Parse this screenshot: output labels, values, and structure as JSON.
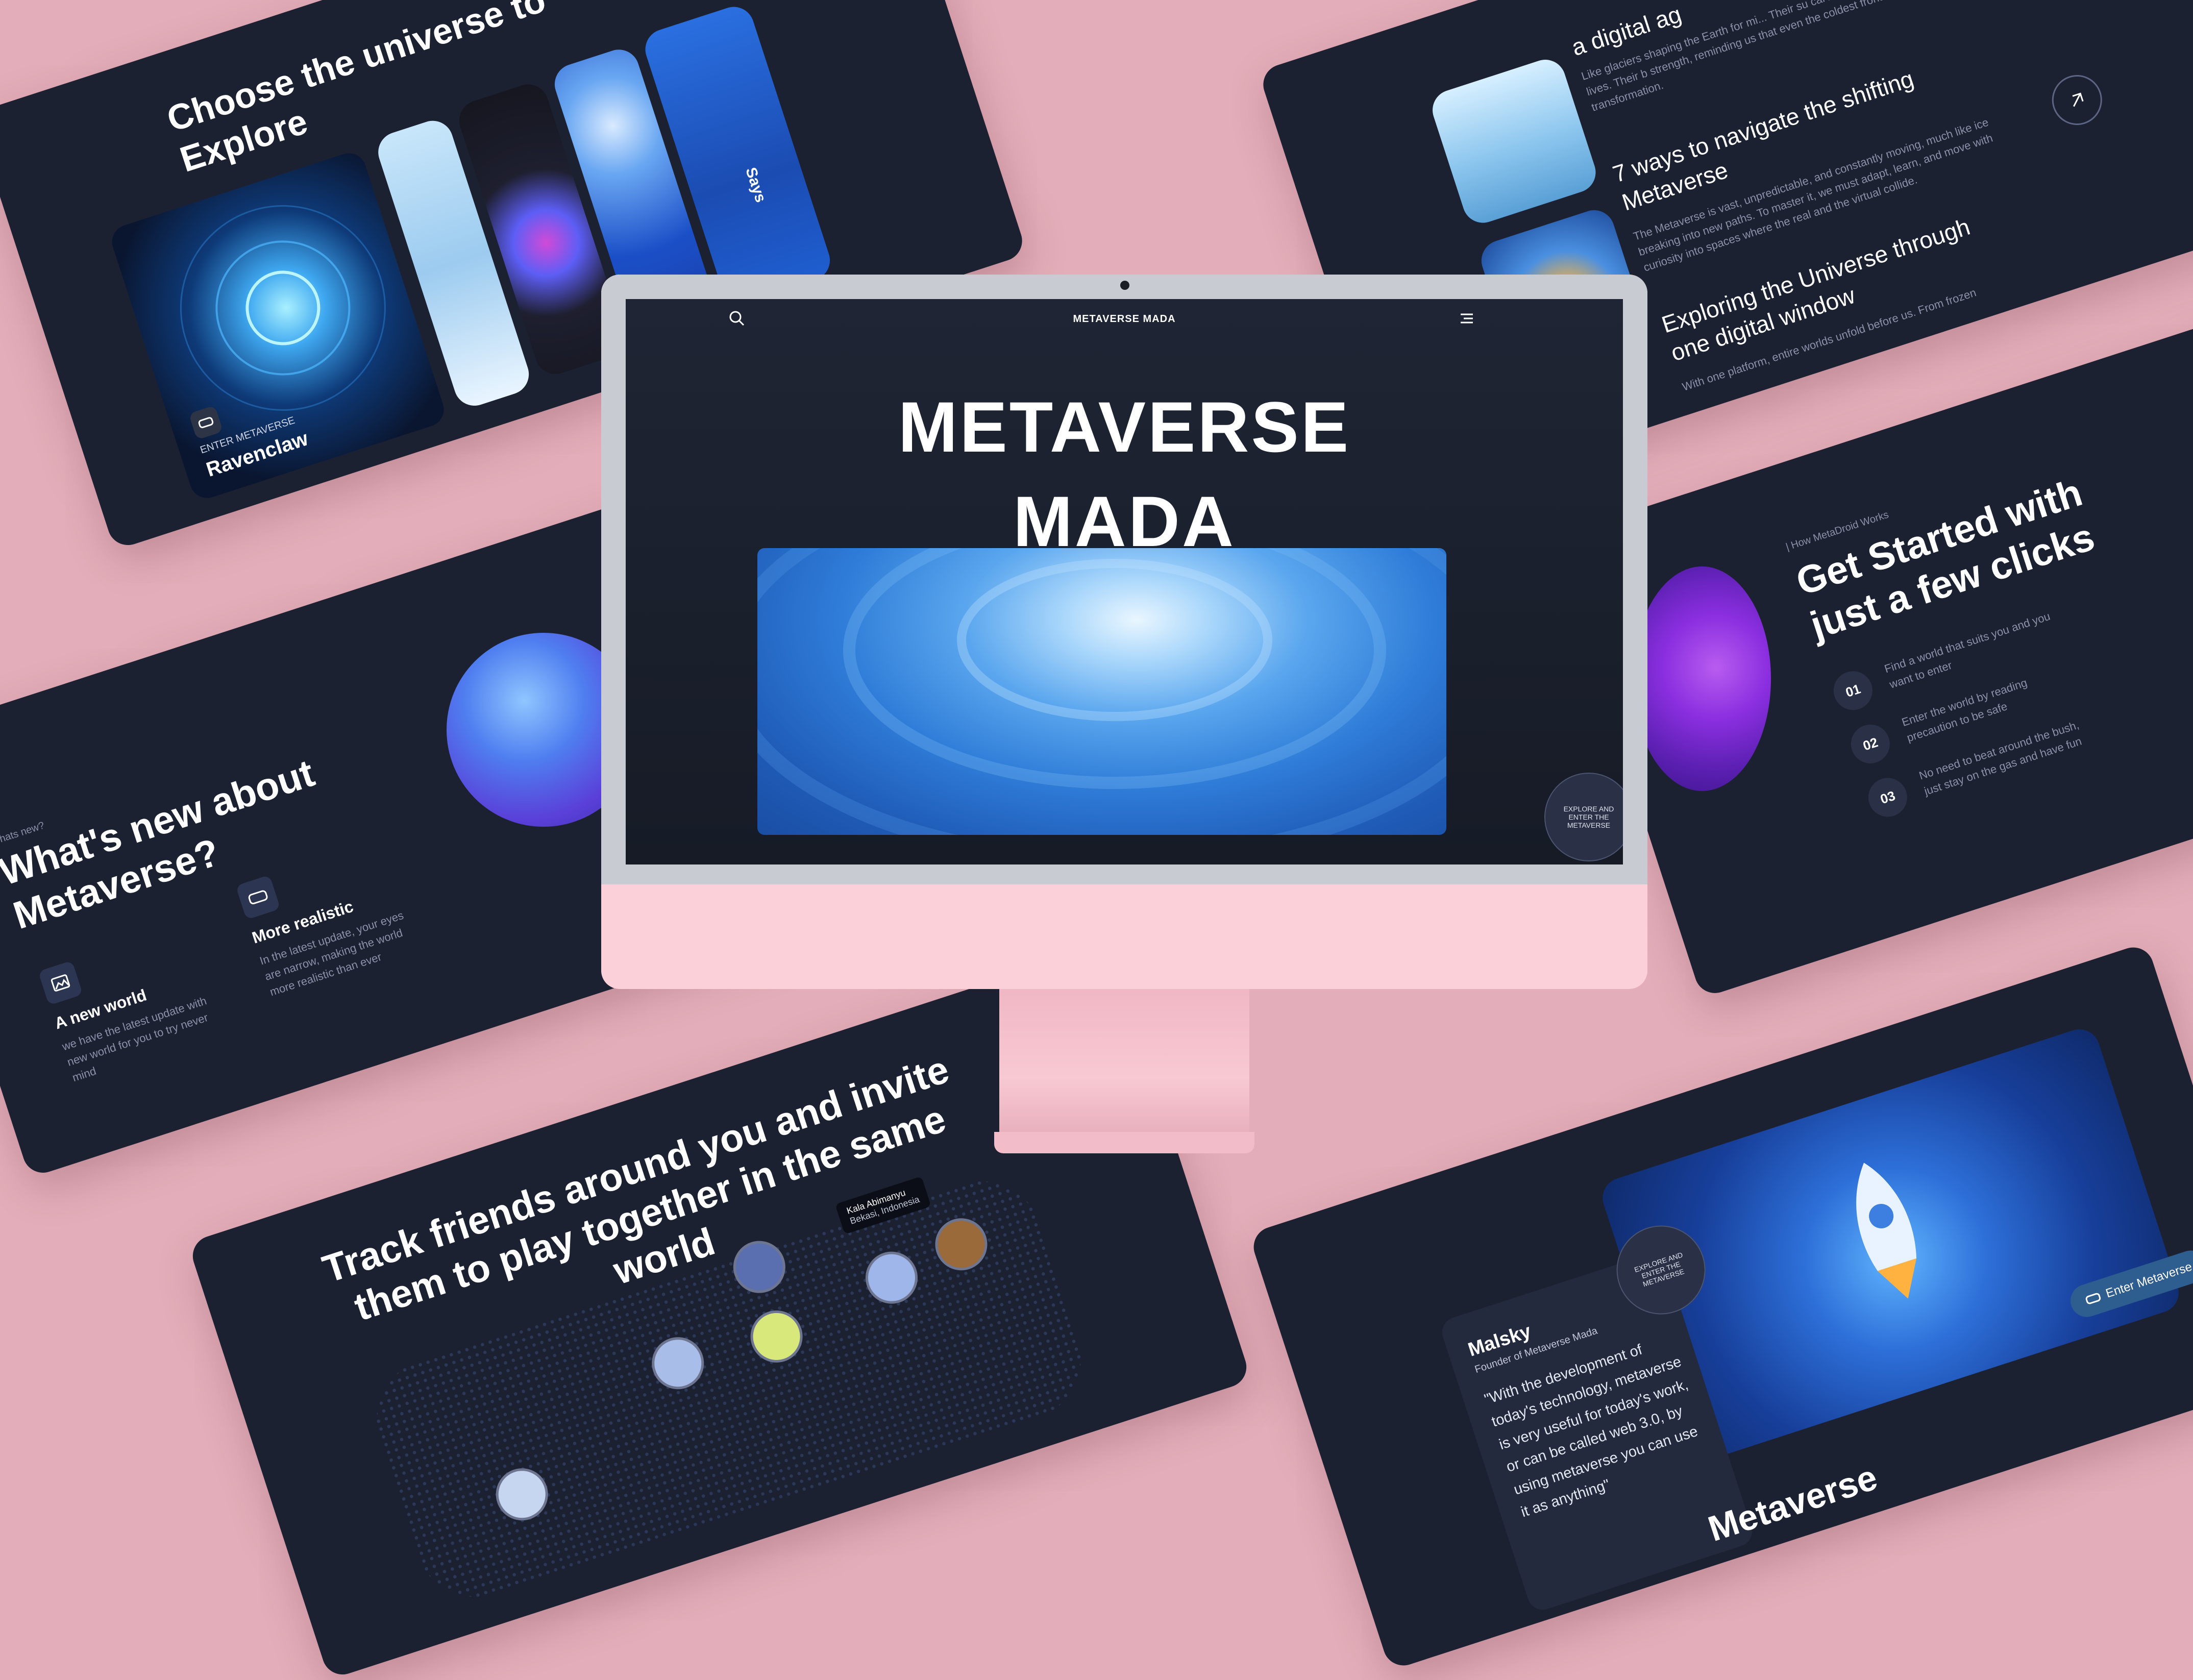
{
  "colors": {
    "background": "#e3aeb9",
    "card": "#1c2131",
    "monitor_chin": "#fcd0d8",
    "accent_blue": "#3d8de0",
    "accent_purple": "#8b2fe0"
  },
  "monitor": {
    "nav_title": "METAVERSE MADA",
    "hero_line1": "METAVERSE",
    "hero_line2": "MADA",
    "explore_badge": "EXPLORE AND ENTER THE METAVERSE",
    "search_icon": "search-icon",
    "menu_icon": "menu-icon"
  },
  "card_explore": {
    "title": "Choose the universe to Explore",
    "enter_label": "ENTER METAVERSE",
    "world_name": "Ravenclaw",
    "side_label": "Says"
  },
  "card_blog": {
    "top_title": "a digital ag",
    "top_text": "Like glaciers shaping the Earth for mi... Their su carves out new landscapes in our lives. Their b strength, reminding us that even the coldest frontier ca transformation.",
    "item1_title": "7 ways to navigate the shifting Metaverse",
    "item1_text": "The Metaverse is vast, unpredictable, and constantly moving, much like ice breaking into new paths. To master it, we must adapt, learn, and move with curiosity into spaces where the real and the virtual collide.",
    "item2_title": "Exploring the Universe through one digital window",
    "item2_text": "With one platform, entire worlds unfold before us. From frozen"
  },
  "card_steps": {
    "eyebrow": "| How MetaDroid Works",
    "title": "Get Started with just a few clicks",
    "steps": [
      {
        "num": "01",
        "text": "Find a world that suits you and you want to enter"
      },
      {
        "num": "02",
        "text": "Enter the world by reading precaution to be safe"
      },
      {
        "num": "03",
        "text": "No need to beat around the bush, just stay on the gas and have fun"
      }
    ]
  },
  "card_whatsnew": {
    "eyebrow": "Whats new?",
    "title": "What's new about Metaverse?",
    "feature1_title": "A new world",
    "feature1_text": "we have the latest update with new world for you to try never mind",
    "feature2_title": "More realistic",
    "feature2_text": "In the latest update, your eyes are narrow, making the world more realistic than ever"
  },
  "card_friends": {
    "title": "Track friends around you and invite them to play together in the same world",
    "tooltip_line1": "Kala Abimanyu",
    "tooltip_line2": "Bekasi, Indonesia"
  },
  "card_founder": {
    "name": "Malsky",
    "role": "Founder of Metaverse Mada",
    "quote": "\"With the development of today's technology, metaverse is very useful for today's work, or can be called web 3.0, by using metaverse you can use it as anything\"",
    "badge": "EXPLORE AND ENTER THE METAVERSE",
    "button_label": "Enter Metaverse",
    "bottom_title": "Metaverse"
  }
}
